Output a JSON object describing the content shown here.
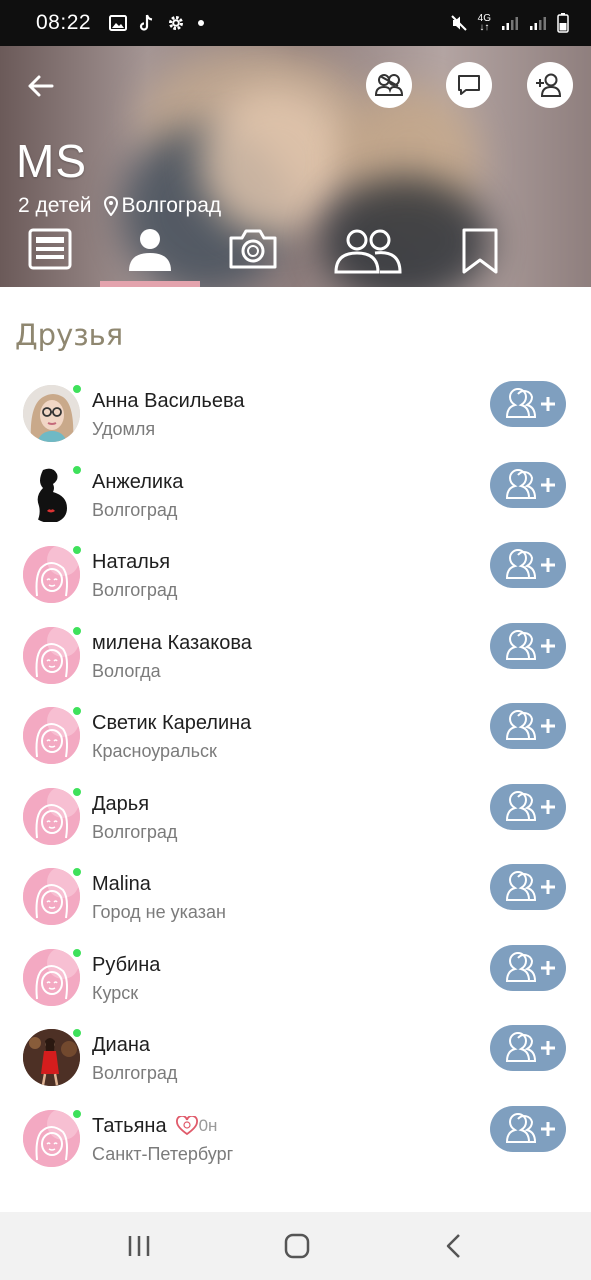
{
  "status_bar": {
    "time": "08:22",
    "network": "4G",
    "icons": [
      "gallery-icon",
      "tiktok-icon",
      "settings-icon",
      "dot-icon",
      "mute-icon",
      "signal-icon",
      "battery-icon"
    ]
  },
  "profile": {
    "name": "MS",
    "children": "2 детей",
    "city": "Волгоград"
  },
  "header_buttons": [
    "couple-icon",
    "message-icon",
    "add-friend-icon"
  ],
  "tabs": [
    {
      "id": "feed",
      "icon": "feed-icon",
      "active": false
    },
    {
      "id": "profile",
      "icon": "user-icon",
      "active": true
    },
    {
      "id": "photos",
      "icon": "camera-icon",
      "active": false
    },
    {
      "id": "friends",
      "icon": "group-icon",
      "active": false
    },
    {
      "id": "bookmarks",
      "icon": "bookmark-icon",
      "active": false
    }
  ],
  "section_title": "Друзья",
  "friends": [
    {
      "name": "Анна Васильева",
      "city": "Удомля",
      "avatar": "photo-glasses",
      "online": true
    },
    {
      "name": "Анжелика",
      "city": "Волгоград",
      "avatar": "silhouette-pregnant",
      "online": true
    },
    {
      "name": "Наталья",
      "city": "Волгоград",
      "avatar": "default-pink",
      "online": true
    },
    {
      "name": "милена Казакова",
      "city": "Вологда",
      "avatar": "default-pink",
      "online": true
    },
    {
      "name": "Светик Карелина",
      "city": "Красноуральск",
      "avatar": "default-pink",
      "online": true
    },
    {
      "name": "Дарья",
      "city": "Волгоград",
      "avatar": "default-pink",
      "online": true
    },
    {
      "name": "Malina",
      "city": "Город не указан",
      "avatar": "default-pink",
      "online": true
    },
    {
      "name": "Рубина",
      "city": "Курск",
      "avatar": "default-pink",
      "online": true
    },
    {
      "name": "Диана",
      "city": "Волгоград",
      "avatar": "photo-red-dress",
      "online": true
    },
    {
      "name": "Татьяна",
      "city": "Санкт-Петербург",
      "avatar": "default-pink",
      "online": true,
      "badge": "0н"
    }
  ],
  "colors": {
    "accent_pink": "#e3a3ad",
    "add_button": "#7f9fbf",
    "online": "#3ee15b",
    "section_title": "#8f8770"
  },
  "nav": [
    "recents-icon",
    "home-icon",
    "back-icon"
  ]
}
